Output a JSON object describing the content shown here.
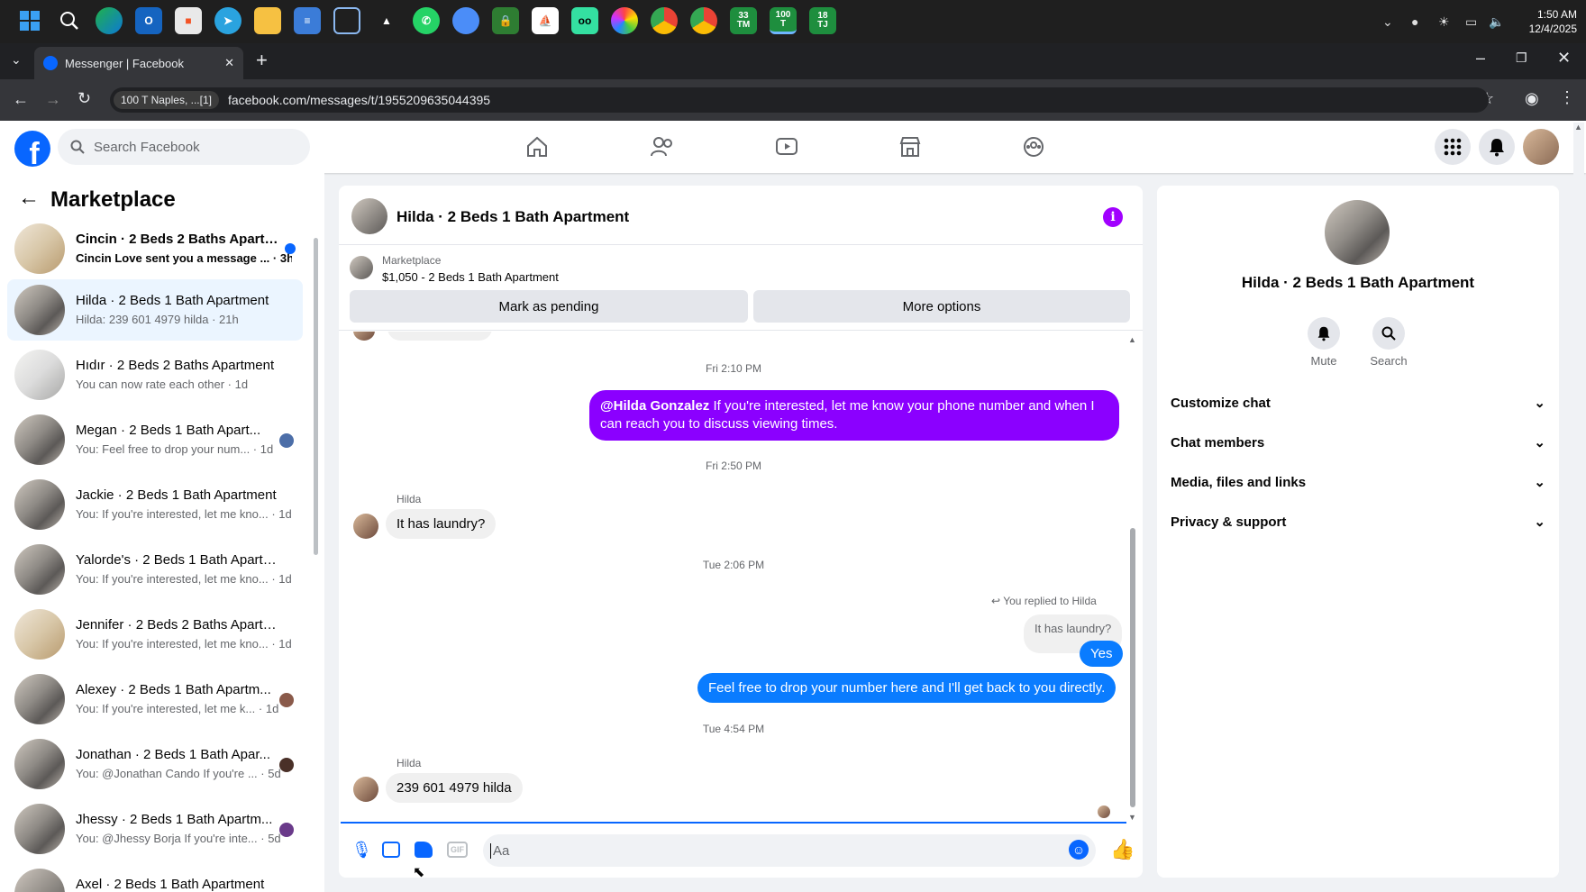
{
  "taskbar": {
    "time": "1:50 AM",
    "date": "12/4/2025",
    "apps": [
      "windows-start",
      "search",
      "edge",
      "outlook",
      "ms-store",
      "telegram",
      "file-explorer",
      "notepad",
      "snipping",
      "inkscape",
      "whatsapp",
      "chrome-blue",
      "vpn-lock",
      "sailboat",
      "tripadvisor",
      "color-app",
      "chrome-red",
      "chrome-a",
      "green-33-tm",
      "green-100-t",
      "green-18-tj"
    ],
    "badges": {
      "green-33-tm": "33\nTM",
      "green-100-t": "100\nT",
      "green-18-tj": "18\nTJ"
    }
  },
  "browser": {
    "tab_title": "Messenger | Facebook",
    "site_chip": "100 T Naples, ...[1]",
    "url": "facebook.com/messages/t/1955209635044395"
  },
  "fb": {
    "search_placeholder": "Search Facebook"
  },
  "sidebar": {
    "title": "Marketplace",
    "conversations": [
      {
        "title": "Cincin · 2 Beds 2 Baths Apartm...",
        "preview": "Cincin Love sent you a message ...",
        "time": "3h",
        "unread": true,
        "thumb": "light"
      },
      {
        "title": "Hilda · 2 Beds 1 Bath Apartment",
        "preview": "Hilda: 239 601 4979 hilda",
        "time": "21h",
        "active": true,
        "thumb": "kitchen"
      },
      {
        "title": "Hıdır · 2 Beds 2 Baths Apartment",
        "preview": "You can now rate each other",
        "time": "1d",
        "thumb": "white"
      },
      {
        "title": "Megan · 2 Beds 1 Bath Apart...",
        "preview": "You: Feel free to drop your num...",
        "time": "1d",
        "thumb": "kitchen"
      },
      {
        "title": "Jackie · 2 Beds 1 Bath Apartment",
        "preview": "You: If you're interested, let me kno...",
        "time": "1d",
        "thumb": "kitchen"
      },
      {
        "title": "Yalorde's · 2 Beds 1 Bath Apartm...",
        "preview": "You: If you're interested, let me kno...",
        "time": "1d",
        "thumb": "kitchen"
      },
      {
        "title": "Jennifer · 2 Beds 2 Baths Apartm...",
        "preview": "You: If you're interested, let me kno...",
        "time": "1d",
        "thumb": "light"
      },
      {
        "title": "Alexey · 2 Beds 1 Bath Apartm...",
        "preview": "You: If you're interested, let me k...",
        "time": "1d",
        "thumb": "kitchen"
      },
      {
        "title": "Jonathan · 2 Beds 1 Bath Apar...",
        "preview": "You: @Jonathan Cando If you're ...",
        "time": "5d",
        "thumb": "kitchen"
      },
      {
        "title": "Jhessy · 2 Beds 1 Bath Apartm...",
        "preview": "You: @Jhessy Borja If you're inte...",
        "time": "5d",
        "thumb": "kitchen"
      },
      {
        "title": "Axel · 2 Beds 1 Bath Apartment",
        "preview": "",
        "time": "",
        "thumb": "kitchen"
      }
    ]
  },
  "chat": {
    "header_title": "Hilda · 2 Beds 1 Bath Apartment",
    "listing_label": "Marketplace",
    "listing_detail": "$1,050 - 2 Beds 1 Bath Apartment",
    "mark_pending": "Mark as pending",
    "more_options": "More options",
    "ts1": "Fri 2:10 PM",
    "msg_out1_mention": "@Hilda Gonzalez",
    "msg_out1_text": " If you're interested, let me know your phone number and when I can reach you to discuss viewing times.",
    "ts2": "Fri 2:50 PM",
    "sender1": "Hilda",
    "msg_in1": "It has laundry?",
    "ts3": "Tue 2:06 PM",
    "replied_label": "You replied to Hilda",
    "quoted": "It has laundry?",
    "msg_out2": "Yes",
    "msg_out3": "Feel free to drop your number here and I'll get back to you directly.",
    "ts4": "Tue 4:54 PM",
    "sender2": "Hilda",
    "msg_in2": "239 601 4979 hilda",
    "composer_placeholder": "Aa",
    "gif_label": "GIF"
  },
  "details": {
    "title": "Hilda · 2 Beds 1 Bath Apartment",
    "mute": "Mute",
    "search": "Search",
    "sections": [
      "Customize chat",
      "Chat members",
      "Media, files and links",
      "Privacy & support"
    ]
  },
  "colors": {
    "fb_blue": "#0866ff",
    "bubble_out": "#0a7cff",
    "mention_bubble": "#8b00ff",
    "info_purple": "#a100ff"
  }
}
